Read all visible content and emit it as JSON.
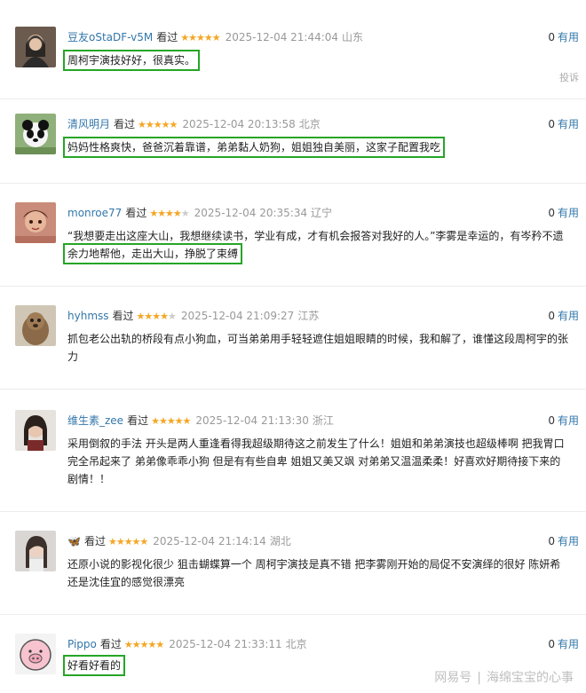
{
  "reviews": [
    {
      "user": "豆友oStaDF-v5M",
      "seen": "看过",
      "stars": 5,
      "time": "2025-12-04 21:44:04",
      "location": "山东",
      "useful_count": "0",
      "useful_label": "有用",
      "lines": [
        "周柯宇演技好好，很真实。"
      ],
      "report": "投诉"
    },
    {
      "user": "清风明月",
      "seen": "看过",
      "stars": 5,
      "time": "2025-12-04 20:13:58",
      "location": "北京",
      "useful_count": "0",
      "useful_label": "有用",
      "lines": [
        "妈妈性格爽快，爸爸沉着靠谱，弟弟黏人奶狗，姐姐独自美丽，这家子配置我吃"
      ]
    },
    {
      "user": "monroe77",
      "seen": "看过",
      "stars": 4,
      "time": "2025-12-04 20:35:34",
      "location": "辽宁",
      "useful_count": "0",
      "useful_label": "有用",
      "lines": [
        "“我想要走出这座大山，我想继续读书，学业有成，才有机会报答对我好的人。”李雾是幸运的，有岑矜不遗",
        "余力地帮他，走出大山，挣脱了束缚"
      ]
    },
    {
      "user": "hyhmss",
      "seen": "看过",
      "stars": 4,
      "time": "2025-12-04 21:09:27",
      "location": "江苏",
      "useful_count": "0",
      "useful_label": "有用",
      "lines": [
        "抓包老公出轨的桥段有点小狗血，可当弟弟用手轻轻遮住姐姐眼睛的时候，我和解了，谁懂这段周柯宇的张",
        "力"
      ]
    },
    {
      "user": "维生素_zee",
      "seen": "看过",
      "stars": 5,
      "time": "2025-12-04 21:13:30",
      "location": "浙江",
      "useful_count": "0",
      "useful_label": "有用",
      "lines": [
        "采用倒叙的手法 开头是两人重逢看得我超级期待这之前发生了什么！姐姐和弟弟演技也超级棒啊 把我胃口",
        "完全吊起来了 弟弟像乖乖小狗 但是有有些自卑 姐姐又美又飒 对弟弟又温温柔柔！好喜欢好期待接下来的",
        "剧情！！"
      ]
    },
    {
      "user": "🦋",
      "seen": "看过",
      "stars": 5,
      "time": "2025-12-04 21:14:14",
      "location": "湖北",
      "useful_count": "0",
      "useful_label": "有用",
      "lines": [
        "还原小说的影视化很少 狙击蝴蝶算一个 周柯宇演技是真不错 把李雾刚开始的局促不安演绎的很好 陈妍希",
        "还是沈佳宜的感觉很漂亮"
      ]
    },
    {
      "user": "Pippo",
      "seen": "看过",
      "stars": 5,
      "time": "2025-12-04 21:33:11",
      "location": "北京",
      "useful_count": "0",
      "useful_label": "有用",
      "lines": [
        "好看好看的"
      ]
    }
  ],
  "watermark": {
    "site": "网易号",
    "author": "海绵宝宝的心事"
  }
}
